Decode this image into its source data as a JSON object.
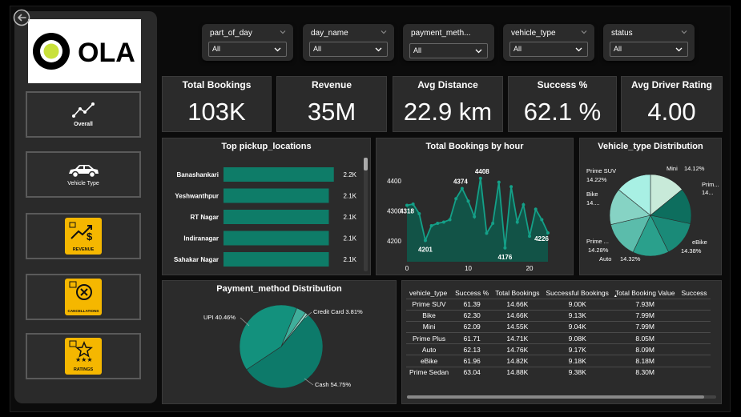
{
  "brand": {
    "logo_text": "OLA"
  },
  "nav": [
    {
      "label": "Overall",
      "icon": "line-chart-icon"
    },
    {
      "label": "Vehicle Type",
      "icon": "car-icon"
    },
    {
      "label": "REVENUE",
      "icon": "revenue-icon"
    },
    {
      "label": "CANCELLATIONS",
      "icon": "cancel-icon"
    },
    {
      "label": "RATINGS",
      "icon": "stars-icon"
    }
  ],
  "slicers": [
    {
      "title": "part_of_day",
      "value": "All"
    },
    {
      "title": "day_name",
      "value": "All"
    },
    {
      "title": "payment_meth...",
      "value": "All"
    },
    {
      "title": "vehicle_type",
      "value": "All"
    },
    {
      "title": "status",
      "value": "All"
    }
  ],
  "kpis": [
    {
      "title": "Total Bookings",
      "value": "103K"
    },
    {
      "title": "Revenue",
      "value": "35M"
    },
    {
      "title": "Avg Distance",
      "value": "22.9 km"
    },
    {
      "title": "Success %",
      "value": "62.1 %"
    },
    {
      "title": "Avg Driver Rating",
      "value": "4.00"
    }
  ],
  "colors": {
    "teal": "#0e7c68",
    "bg": "#0b0b0b",
    "panel": "#2b2b2b",
    "brand_yellow": "#f5b700",
    "logo_green": "#c9e13a"
  },
  "chart_data": [
    {
      "type": "bar",
      "title": "Top pickup_locations",
      "categories": [
        "Banashankari",
        "Yeshwanthpur",
        "RT Nagar",
        "Indiranagar",
        "Sahakar Nagar"
      ],
      "values": [
        2200,
        2100,
        2100,
        2100,
        2100
      ],
      "data_labels": [
        "2.2K",
        "2.1K",
        "2.1K",
        "2.1K",
        "2.1K"
      ],
      "orientation": "horizontal"
    },
    {
      "type": "area",
      "title": "Total Bookings by hour",
      "x": [
        0,
        1,
        2,
        3,
        4,
        5,
        6,
        7,
        8,
        9,
        10,
        11,
        12,
        13,
        14,
        15,
        16,
        17,
        18,
        19,
        20,
        21,
        22,
        23
      ],
      "y": [
        4318,
        4322,
        4290,
        4201,
        4250,
        4258,
        4262,
        4270,
        4340,
        4374,
        4332,
        4280,
        4408,
        4225,
        4258,
        4395,
        4176,
        4380,
        4262,
        4320,
        4215,
        4305,
        4270,
        4226
      ],
      "point_labels": [
        {
          "x": 0,
          "label": "4318"
        },
        {
          "x": 3,
          "label": "4201"
        },
        {
          "x": 9,
          "label": "4374"
        },
        {
          "x": 12,
          "label": "4408"
        },
        {
          "x": 16,
          "label": "4176"
        },
        {
          "x": 23,
          "label": "4226"
        }
      ],
      "x_ticks": [
        "0",
        "10",
        "20"
      ],
      "y_ticks": [
        "4200",
        "4300",
        "4400"
      ],
      "ylim": [
        4130,
        4450
      ]
    },
    {
      "type": "pie",
      "title": "Vehicle_type Distribution",
      "slices": [
        {
          "name": "Mini",
          "label": "14.12%",
          "value": 14.12,
          "color": "#c8ead9"
        },
        {
          "name": "Prim...",
          "label": "14...",
          "value": 14.22,
          "color": "#0d6e5e"
        },
        {
          "name": "eBike",
          "label": "14.38%",
          "value": 14.38,
          "color": "#1a8a78"
        },
        {
          "name": "Auto",
          "label": "14.32%",
          "value": 14.32,
          "color": "#2aa08c"
        },
        {
          "name": "Prime ...",
          "label": "14.28%",
          "value": 14.28,
          "color": "#5bbcab"
        },
        {
          "name": "Bike",
          "label": "14....",
          "value": 14.46,
          "color": "#86d3c4"
        },
        {
          "name": "Prime SUV",
          "label": "14.22%",
          "value": 14.22,
          "color": "#a8f0e4"
        }
      ]
    },
    {
      "type": "pie",
      "title": "Payment_method Distribution",
      "slices": [
        {
          "name": "Cash",
          "label": "Cash 54.75%",
          "value": 54.75,
          "color": "#0d7a6a"
        },
        {
          "name": "UPI",
          "label": "UPI 40.46%",
          "value": 40.46,
          "color": "#13917d"
        },
        {
          "name": "Credit Card",
          "label": "Credit Card 3.81%",
          "value": 3.81,
          "color": "#3fae9b"
        },
        {
          "name": "Other",
          "label": "",
          "value": 0.98,
          "color": "#8fd4c6"
        }
      ]
    },
    {
      "type": "table",
      "columns": [
        "vehicle_type",
        "Success %",
        "Total Bookings",
        "Successful Bookings",
        "Total Booking Value",
        "Success"
      ],
      "rows": [
        [
          "Prime SUV",
          "61.39",
          "14.66K",
          "9.00K",
          "7.93M",
          ""
        ],
        [
          "Bike",
          "62.30",
          "14.66K",
          "9.13K",
          "7.99M",
          ""
        ],
        [
          "Mini",
          "62.09",
          "14.55K",
          "9.04K",
          "7.99M",
          ""
        ],
        [
          "Prime Plus",
          "61.71",
          "14.71K",
          "9.08K",
          "8.05M",
          ""
        ],
        [
          "Auto",
          "62.13",
          "14.76K",
          "9.17K",
          "8.09M",
          ""
        ],
        [
          "eBike",
          "61.96",
          "14.82K",
          "9.18K",
          "8.18M",
          ""
        ],
        [
          "Prime Sedan",
          "63.04",
          "14.88K",
          "9.38K",
          "8.30M",
          ""
        ]
      ],
      "sort_column": "Total Booking Value"
    }
  ]
}
